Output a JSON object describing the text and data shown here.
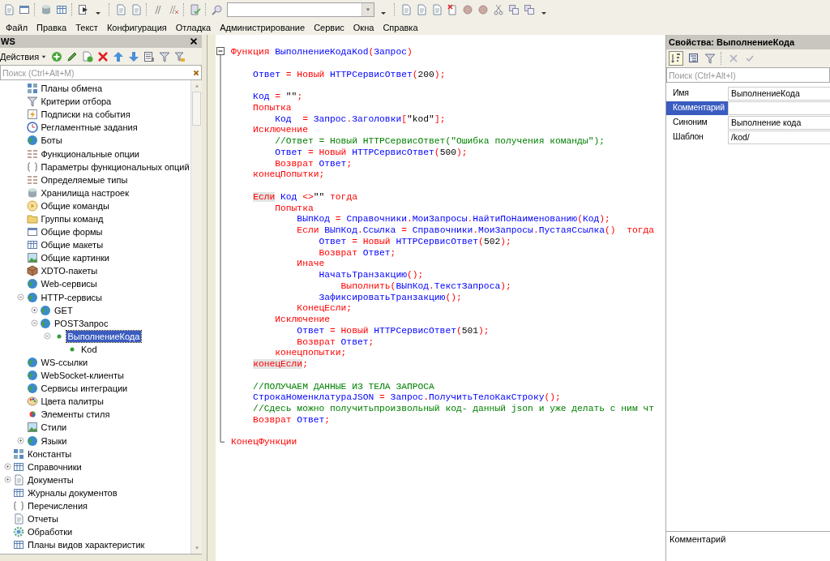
{
  "menu": [
    "Файл",
    "Правка",
    "Текст",
    "Конфигурация",
    "Отладка",
    "Администрирование",
    "Сервис",
    "Окна",
    "Справка"
  ],
  "config_panel": {
    "title": "WS",
    "actions_label": "Действия",
    "search": {
      "placeholder": "Поиск (Ctrl+Alt+M)"
    },
    "tree": [
      {
        "expanded": true,
        "children": [
          {
            "label": "Планы обмена"
          },
          {
            "label": "Критерии отбора"
          },
          {
            "label": "Подписки на события"
          },
          {
            "label": "Регламентные задания"
          },
          {
            "label": "Боты"
          },
          {
            "label": "Функциональные опции"
          },
          {
            "label": "Параметры функциональных опций"
          },
          {
            "label": "Определяемые типы"
          },
          {
            "label": "Хранилища настроек"
          },
          {
            "label": "Общие команды"
          },
          {
            "label": "Группы команд"
          },
          {
            "label": "Общие формы"
          },
          {
            "label": "Общие макеты"
          },
          {
            "label": "Общие картинки"
          },
          {
            "label": "XDTO-пакеты"
          },
          {
            "label": "Web-сервисы"
          },
          {
            "label": "HTTP-сервисы",
            "expanded": true,
            "children": [
              {
                "label": "GET",
                "expanded": false
              },
              {
                "label": "POSTЗапрос",
                "expanded": true,
                "children": [
                  {
                    "label": "ВыполнениеКода",
                    "expanded": true,
                    "selected": true,
                    "children": [
                      {
                        "label": "Kod",
                        "selected": false
                      }
                    ]
                  }
                ]
              }
            ]
          },
          {
            "label": "WS-ссылки"
          },
          {
            "label": "WebSocket-клиенты"
          },
          {
            "label": "Сервисы интеграции"
          },
          {
            "label": "Цвета палитры"
          },
          {
            "label": "Элементы стиля"
          },
          {
            "label": "Стили"
          },
          {
            "label": "Языки",
            "expanded": false
          }
        ]
      },
      {
        "label": "Константы"
      },
      {
        "label": "Справочники",
        "expanded": false
      },
      {
        "label": "Документы",
        "expanded": false
      },
      {
        "label": "Журналы документов"
      },
      {
        "label": "Перечисления"
      },
      {
        "label": "Отчеты"
      },
      {
        "label": "Обработки"
      },
      {
        "label": "Планы видов характеристик"
      }
    ]
  },
  "code": [
    {
      "kind": "code",
      "tokens": [
        {
          "kind": "kw",
          "text": "Функция "
        },
        {
          "kind": "id",
          "text": "ВыполнениеКодаKod"
        },
        {
          "kind": "kw",
          "text": "("
        },
        {
          "kind": "id",
          "text": "Запрос"
        },
        {
          "kind": "kw",
          "text": ")"
        }
      ]
    },
    {
      "kind": "blank"
    },
    {
      "kind": "code",
      "tokens": [
        {
          "kind": "id",
          "text": "    Ответ"
        },
        {
          "kind": "kw",
          "text": " = Новый "
        },
        {
          "kind": "id",
          "text": "HTTPСервисОтвет"
        },
        {
          "kind": "kw",
          "text": "("
        },
        {
          "kind": "lit",
          "text": "200"
        },
        {
          "kind": "kw",
          "text": ");"
        }
      ]
    },
    {
      "kind": "blank"
    },
    {
      "kind": "code",
      "tokens": [
        {
          "kind": "id",
          "text": "    Код"
        },
        {
          "kind": "kw",
          "text": " = "
        },
        {
          "kind": "lit",
          "text": "\"\""
        },
        {
          "kind": "kw",
          "text": ";"
        }
      ]
    },
    {
      "kind": "code",
      "tokens": [
        {
          "kind": "kw",
          "text": "    Попытка"
        }
      ]
    },
    {
      "kind": "code",
      "tokens": [
        {
          "kind": "id",
          "text": "        Код"
        },
        {
          "kind": "kw",
          "text": "  = "
        },
        {
          "kind": "id",
          "text": "Запрос"
        },
        {
          "kind": "kw",
          "text": "."
        },
        {
          "kind": "id",
          "text": "Заголовки"
        },
        {
          "kind": "kw",
          "text": "["
        },
        {
          "kind": "lit",
          "text": "\"kod\""
        },
        {
          "kind": "kw",
          "text": "];"
        }
      ]
    },
    {
      "kind": "code",
      "tokens": [
        {
          "kind": "kw",
          "text": "    Исключение"
        }
      ]
    },
    {
      "kind": "code",
      "tokens": [
        {
          "kind": "com",
          "text": "        //Ответ = Новый HTTPСервисОтвет(\"Ошибка получения команды\");"
        }
      ]
    },
    {
      "kind": "code",
      "tokens": [
        {
          "kind": "id",
          "text": "        Ответ"
        },
        {
          "kind": "kw",
          "text": " = Новый "
        },
        {
          "kind": "id",
          "text": "HTTPСервисОтвет"
        },
        {
          "kind": "kw",
          "text": "("
        },
        {
          "kind": "lit",
          "text": "500"
        },
        {
          "kind": "kw",
          "text": ");"
        }
      ]
    },
    {
      "kind": "code",
      "tokens": [
        {
          "kind": "kw",
          "text": "        Возврат "
        },
        {
          "kind": "id",
          "text": "Ответ"
        },
        {
          "kind": "kw",
          "text": ";"
        }
      ]
    },
    {
      "kind": "code",
      "tokens": [
        {
          "kind": "kw",
          "text": "    конецПопытки;"
        }
      ]
    },
    {
      "kind": "blank"
    },
    {
      "kind": "code",
      "tokens": [
        {
          "kind": "kw",
          "text": "    Если",
          "highlight": true
        },
        {
          "kind": "id",
          "text": " Код "
        },
        {
          "kind": "kw",
          "text": "<>"
        },
        {
          "kind": "lit",
          "text": "\"\""
        },
        {
          "kind": "kw",
          "text": " тогда"
        }
      ]
    },
    {
      "kind": "code",
      "tokens": [
        {
          "kind": "kw",
          "text": "        Попытка"
        }
      ]
    },
    {
      "kind": "code",
      "tokens": [
        {
          "kind": "id",
          "text": "            ВЫпКод"
        },
        {
          "kind": "kw",
          "text": " = "
        },
        {
          "kind": "id",
          "text": "Справочники"
        },
        {
          "kind": "kw",
          "text": "."
        },
        {
          "kind": "id",
          "text": "МоиЗапросы"
        },
        {
          "kind": "kw",
          "text": "."
        },
        {
          "kind": "id",
          "text": "НайтиПоНаименованию"
        },
        {
          "kind": "kw",
          "text": "("
        },
        {
          "kind": "id",
          "text": "Код"
        },
        {
          "kind": "kw",
          "text": ");"
        }
      ]
    },
    {
      "kind": "code",
      "tokens": [
        {
          "kind": "kw",
          "text": "            Если "
        },
        {
          "kind": "id",
          "text": "ВЫпКод"
        },
        {
          "kind": "kw",
          "text": "."
        },
        {
          "kind": "id",
          "text": "Ссылка"
        },
        {
          "kind": "kw",
          "text": " = "
        },
        {
          "kind": "id",
          "text": "Справочники"
        },
        {
          "kind": "kw",
          "text": "."
        },
        {
          "kind": "id",
          "text": "МоиЗапросы"
        },
        {
          "kind": "kw",
          "text": "."
        },
        {
          "kind": "id",
          "text": "ПустаяСсылка"
        },
        {
          "kind": "kw",
          "text": "()  тогда"
        }
      ]
    },
    {
      "kind": "code",
      "tokens": [
        {
          "kind": "id",
          "text": "                Ответ"
        },
        {
          "kind": "kw",
          "text": " = Новый "
        },
        {
          "kind": "id",
          "text": "HTTPСервисОтвет"
        },
        {
          "kind": "kw",
          "text": "("
        },
        {
          "kind": "lit",
          "text": "502"
        },
        {
          "kind": "kw",
          "text": ");"
        }
      ]
    },
    {
      "kind": "code",
      "tokens": [
        {
          "kind": "kw",
          "text": "                Возврат "
        },
        {
          "kind": "id",
          "text": "Ответ"
        },
        {
          "kind": "kw",
          "text": ";"
        }
      ]
    },
    {
      "kind": "code",
      "tokens": [
        {
          "kind": "kw",
          "text": "            Иначе"
        }
      ]
    },
    {
      "kind": "code",
      "tokens": [
        {
          "kind": "id",
          "text": "                НачатьТранзакцию"
        },
        {
          "kind": "kw",
          "text": "();"
        }
      ]
    },
    {
      "kind": "code",
      "tokens": [
        {
          "kind": "kw",
          "text": "                    Выполнить("
        },
        {
          "kind": "id",
          "text": "ВЫпКод"
        },
        {
          "kind": "kw",
          "text": "."
        },
        {
          "kind": "id",
          "text": "ТекстЗапроса"
        },
        {
          "kind": "kw",
          "text": ");"
        }
      ]
    },
    {
      "kind": "code",
      "tokens": [
        {
          "kind": "id",
          "text": "                ЗафиксироватьТранзакцию"
        },
        {
          "kind": "kw",
          "text": "();"
        }
      ]
    },
    {
      "kind": "code",
      "tokens": [
        {
          "kind": "kw",
          "text": "            КонецЕсли;"
        }
      ]
    },
    {
      "kind": "code",
      "tokens": [
        {
          "kind": "kw",
          "text": "        Исключение"
        }
      ]
    },
    {
      "kind": "code",
      "tokens": [
        {
          "kind": "id",
          "text": "            Ответ"
        },
        {
          "kind": "kw",
          "text": " = Новый "
        },
        {
          "kind": "id",
          "text": "HTTPСервисОтвет"
        },
        {
          "kind": "kw",
          "text": "("
        },
        {
          "kind": "lit",
          "text": "501"
        },
        {
          "kind": "kw",
          "text": ");"
        }
      ]
    },
    {
      "kind": "code",
      "tokens": [
        {
          "kind": "kw",
          "text": "            Возврат "
        },
        {
          "kind": "id",
          "text": "Ответ"
        },
        {
          "kind": "kw",
          "text": ";"
        }
      ]
    },
    {
      "kind": "code",
      "tokens": [
        {
          "kind": "kw",
          "text": "        конецпопытки;"
        }
      ]
    },
    {
      "kind": "code",
      "tokens": [
        {
          "kind": "kw",
          "text": "    конецЕсли",
          "highlight": true
        },
        {
          "kind": "kw",
          "text": ";"
        }
      ]
    },
    {
      "kind": "blank"
    },
    {
      "kind": "code",
      "tokens": [
        {
          "kind": "com",
          "text": "    //ПОЛУЧАЕМ ДАННЫЕ ИЗ ТЕЛА ЗАПРОСА"
        }
      ]
    },
    {
      "kind": "code",
      "tokens": [
        {
          "kind": "id",
          "text": "    СтрокаНоменклатураJSON"
        },
        {
          "kind": "kw",
          "text": " = "
        },
        {
          "kind": "id",
          "text": "Запрос"
        },
        {
          "kind": "kw",
          "text": "."
        },
        {
          "kind": "id",
          "text": "ПолучитьТелоКакСтроку"
        },
        {
          "kind": "kw",
          "text": "();"
        }
      ]
    },
    {
      "kind": "code",
      "tokens": [
        {
          "kind": "com",
          "text": "    //Сдесь можно получитьпроизвольный код- данный json и уже делать с ним чт"
        }
      ]
    },
    {
      "kind": "code",
      "tokens": [
        {
          "kind": "kw",
          "text": "    Возврат "
        },
        {
          "kind": "id",
          "text": "Ответ"
        },
        {
          "kind": "kw",
          "text": ";"
        }
      ]
    },
    {
      "kind": "blank"
    },
    {
      "kind": "code",
      "tokens": [
        {
          "kind": "kw",
          "text": "КонецФункции"
        }
      ]
    }
  ],
  "properties": {
    "title": "Свойства: ВыполнениеКода",
    "search": {
      "placeholder": "Поиск (Ctrl+Alt+I)"
    },
    "rows": [
      {
        "name": "Имя",
        "value": "ВыполнениеКода",
        "selected": false
      },
      {
        "name": "Комментарий",
        "selected": true
      },
      {
        "name": "Синоним",
        "value": "Выполнение кода",
        "selected": false
      },
      {
        "name": "Шаблон",
        "value": "/kod/",
        "selected": false
      }
    ],
    "comment_label": "Комментарий"
  }
}
